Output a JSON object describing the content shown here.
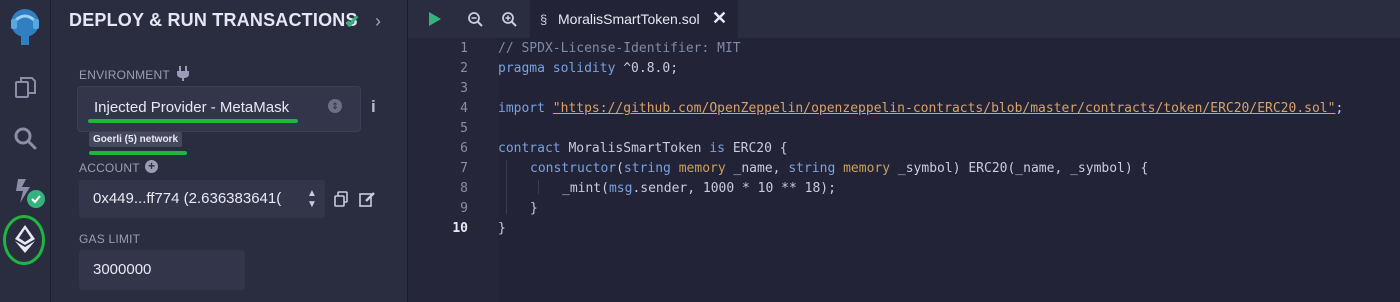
{
  "panel": {
    "title": "DEPLOY & RUN TRANSACTIONS",
    "environment_label": "ENVIRONMENT",
    "environment_value": "Injected Provider - MetaMask",
    "network_badge": "Goerli (5) network",
    "account_label": "ACCOUNT",
    "account_value": "0x449...ff774 (2.636383641(",
    "gas_limit_label": "GAS LIMIT",
    "gas_limit_value": "3000000"
  },
  "editor": {
    "tab_name": "MoralisSmartToken.sol",
    "line_numbers": [
      "1",
      "2",
      "3",
      "4",
      "5",
      "6",
      "7",
      "8",
      "9",
      "10"
    ],
    "code": {
      "l1": "// SPDX-License-Identifier: MIT",
      "l2_kw": "pragma solidity",
      "l2_rest": " ^0.8.0;",
      "l4_kw": "import",
      "l4_str": "\"https://github.com/OpenZeppelin/openzeppelin-contracts/blob/master/contracts/token/ERC20/ERC20.sol\"",
      "l4_end": ";",
      "l6_kw": "contract",
      "l6_name": " MoralisSmartToken ",
      "l6_kw2": "is",
      "l6_rest": " ERC20 {",
      "l7_kw": "constructor",
      "l7_a": "(",
      "l7_t1": "string",
      "l7_m1": " memory",
      "l7_b": " _name, ",
      "l7_t2": "string",
      "l7_m2": " memory",
      "l7_c": " _symbol) ERC20(_name, _symbol) {",
      "l8_a": "_mint(",
      "l8_kw": "msg",
      "l8_b": ".sender, 1000 * 10 ** 18);",
      "l9": "}",
      "l10": "}"
    }
  },
  "colors": {
    "accent_green": "#1fb53f",
    "check_green": "#35b37e",
    "panel_bg": "#2a2c3f",
    "editor_bg": "#222336"
  },
  "icons": [
    "remix-logo-icon",
    "file-explorer-icon",
    "search-icon",
    "compiler-icon",
    "deploy-icon",
    "plug-icon",
    "info-icon",
    "plus-icon",
    "copy-icon",
    "edit-icon",
    "play-icon",
    "zoom-out-icon",
    "zoom-in-icon",
    "solidity-file-icon",
    "close-icon",
    "chevron-right-icon",
    "check-icon"
  ]
}
